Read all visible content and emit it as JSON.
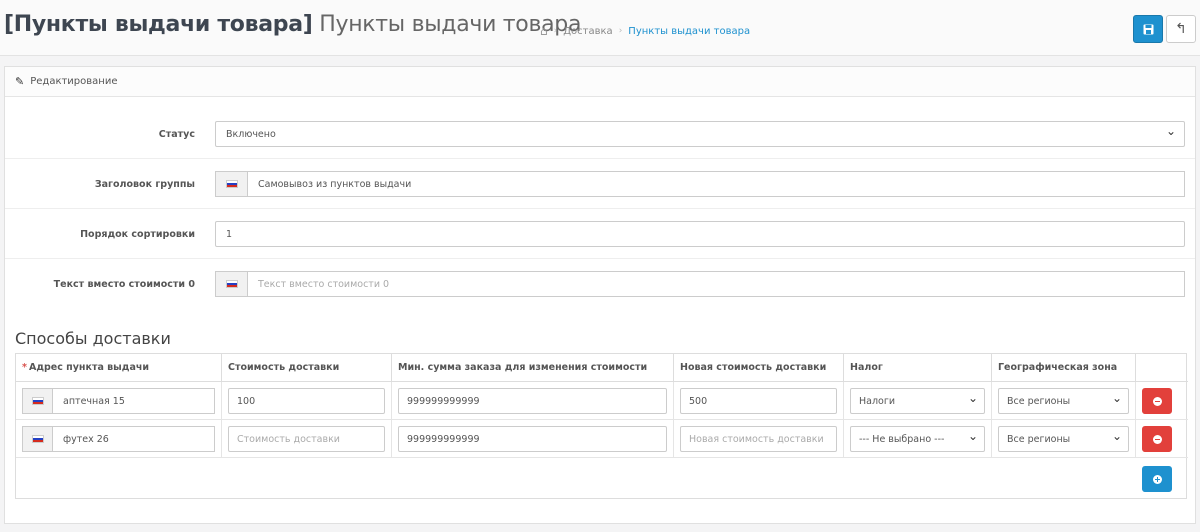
{
  "header": {
    "title_bold": "[Пункты выдачи товара]",
    "title_sub": "Пункты выдачи товара",
    "breadcrumb": [
      "Доставка",
      "Пункты выдачи товара"
    ]
  },
  "panel": {
    "heading": "Редактирование",
    "fields": {
      "status_label": "Статус",
      "status_value": "Включено",
      "group_title_label": "Заголовок группы",
      "group_title_value": "Самовывоз из пунктов выдачи",
      "sort_order_label": "Порядок сортировки",
      "sort_order_value": "1",
      "zero_cost_text_label": "Текст вместо стоимости 0",
      "zero_cost_text_placeholder": "Текст вместо стоимости 0"
    }
  },
  "methods": {
    "title": "Способы доставки",
    "columns": {
      "address": "Адрес пункта выдачи",
      "cost": "Стоимость доставки",
      "min_sum": "Мин. сумма заказа для изменения стоимости",
      "new_cost": "Новая стоимость доставки",
      "tax": "Налог",
      "geo_zone": "Географическая зона"
    },
    "rows": [
      {
        "address": "аптечная 15",
        "cost": "100",
        "cost_placeholder": "",
        "min_sum": "999999999999",
        "new_cost": "500",
        "new_cost_placeholder": "",
        "tax": "Налоги",
        "geo_zone": "Все регионы"
      },
      {
        "address": "футех 26",
        "cost": "",
        "cost_placeholder": "Стоимость доставки",
        "min_sum": "999999999999",
        "new_cost": "",
        "new_cost_placeholder": "Новая стоимость доставки",
        "tax": "--- Не выбрано ---",
        "geo_zone": "Все регионы"
      }
    ]
  },
  "icons": {
    "save": "save-icon",
    "back": "reply-icon",
    "home": "home-icon",
    "pencil": "pencil-icon",
    "remove": "minus-circle-icon",
    "add": "plus-circle-icon",
    "flag": "ru-flag-icon"
  },
  "colors": {
    "primary": "#1e91cf",
    "danger": "#e2403b",
    "link": "#1e91cf"
  }
}
